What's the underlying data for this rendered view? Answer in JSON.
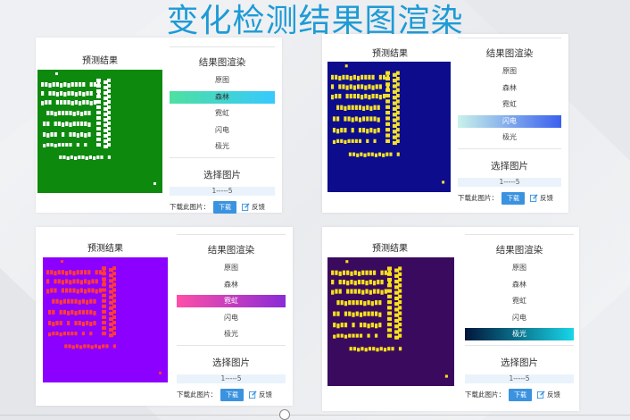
{
  "page_title": "变化检测结果图渲染",
  "panels": [
    {
      "preview_title": "预测结果",
      "render_title": "结果图渲染",
      "options": [
        "原图",
        "森林",
        "霓虹",
        "闪电",
        "极光"
      ],
      "selected": "森林",
      "select_title": "选择图片",
      "range": "1-----5",
      "download_label": "下载此图片：",
      "download_button": "下载",
      "feedback_label": "反馈",
      "colors": {
        "bg": "#0d8a0d",
        "fg": "#ffffff",
        "highlight_from": "#4ee0a0",
        "highlight_to": "#37c9ff"
      }
    },
    {
      "preview_title": "预测结果",
      "render_title": "结果图渲染",
      "options": [
        "原图",
        "森林",
        "霓虹",
        "闪电",
        "极光"
      ],
      "selected": "闪电",
      "select_title": "选择图片",
      "range": "1-----5",
      "download_label": "下载此图片：",
      "download_button": "下载",
      "feedback_label": "反馈",
      "colors": {
        "bg": "#0c0c8c",
        "fg": "#f5e12a",
        "highlight_from": "#c8f2ea",
        "highlight_to": "#3a60ee"
      }
    },
    {
      "preview_title": "预测结果",
      "render_title": "结果图渲染",
      "options": [
        "原图",
        "森林",
        "霓虹",
        "闪电",
        "极光"
      ],
      "selected": "霓虹",
      "select_title": "选择图片",
      "range": "1-----5",
      "download_label": "下载此图片：",
      "download_button": "下载",
      "feedback_label": "反馈",
      "colors": {
        "bg": "#8b00ff",
        "fg": "#ff3b3b",
        "highlight_from": "#ff4fa8",
        "highlight_to": "#8a2bd6"
      }
    },
    {
      "preview_title": "预测结果",
      "render_title": "结果图渲染",
      "options": [
        "原图",
        "森林",
        "霓虹",
        "闪电",
        "极光"
      ],
      "selected": "极光",
      "select_title": "选择图片",
      "range": "1-----5",
      "download_label": "下载此图片：",
      "download_button": "下载",
      "feedback_label": "反馈",
      "colors": {
        "bg": "#3a0a5e",
        "fg": "#f7e21c",
        "highlight_from": "#00163a",
        "highlight_to": "#18d6e8"
      }
    }
  ]
}
